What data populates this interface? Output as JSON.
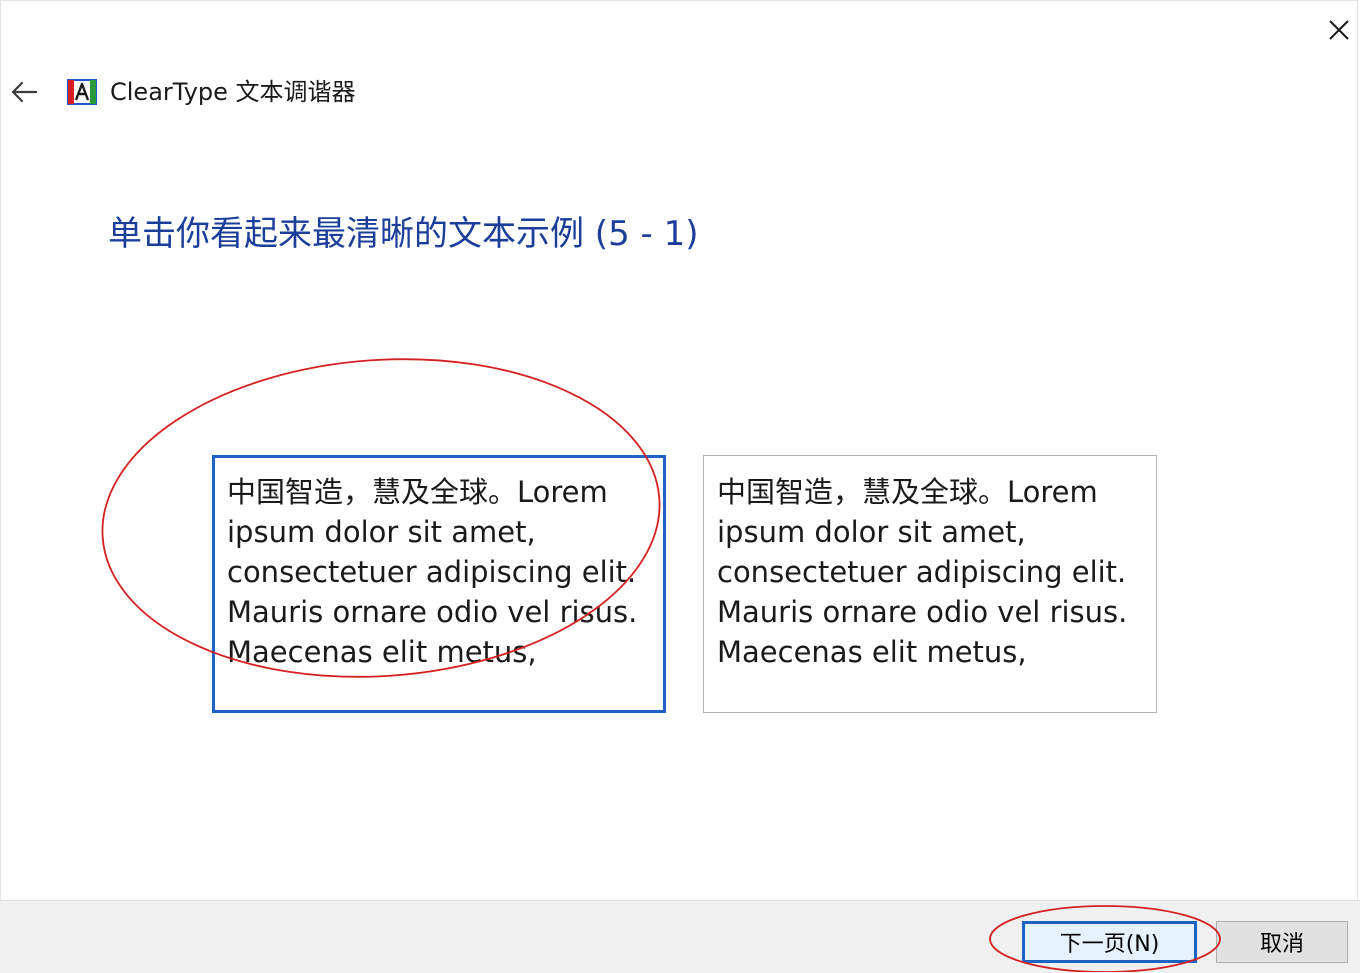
{
  "window": {
    "title": "ClearType 文本调谐器",
    "close_icon": "close-icon",
    "back_icon": "arrow-left-icon",
    "app_icon": "cleartype-a-icon"
  },
  "page": {
    "heading": "单击你看起来最清晰的文本示例 (5 - 1)"
  },
  "samples": [
    {
      "text": "中国智造，慧及全球。Lorem\nipsum dolor sit amet,\nconsectetuer adipiscing elit.\nMauris ornare odio vel risus.\nMaecenas elit metus,",
      "selected": true
    },
    {
      "text": "中国智造，慧及全球。Lorem\nipsum dolor sit amet,\nconsectetuer adipiscing elit.\nMauris ornare odio vel risus.\nMaecenas elit metus,",
      "selected": false
    }
  ],
  "footer": {
    "next_label": "下一页(N)",
    "cancel_label": "取消"
  },
  "colors": {
    "heading": "#1a3e9a",
    "selection_border": "#1c63c4",
    "annotation_circle": "#d42020",
    "footer_bg": "#f0f0f0"
  }
}
